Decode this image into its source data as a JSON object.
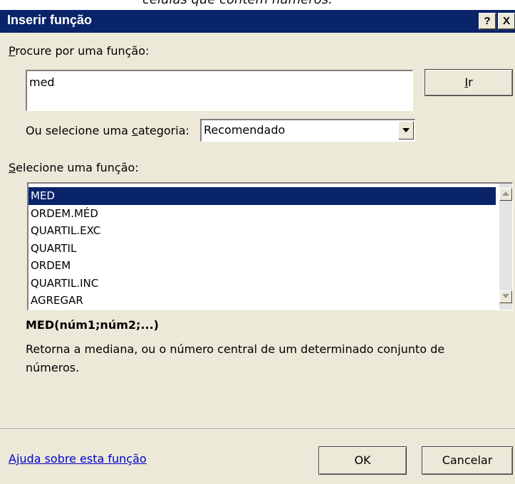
{
  "caption_above": "células que contêm números.",
  "dialog": {
    "title": "Inserir função",
    "help_glyph": "?",
    "close_glyph": "X"
  },
  "search": {
    "label": "rocure por uma função:",
    "label_mnemonic": "P",
    "value": "med",
    "go_label": "r",
    "go_mnemonic": "I"
  },
  "category": {
    "label_before": "Ou selecione uma ",
    "label_mnemonic": "c",
    "label_after": "ategoria:",
    "selected": "Recomendado"
  },
  "function_list": {
    "label": "elecione uma função:",
    "label_mnemonic": "S",
    "items": [
      "MED",
      "ORDEM.MÉD",
      "QUARTIL.EXC",
      "QUARTIL",
      "ORDEM",
      "QUARTIL.INC",
      "AGREGAR"
    ],
    "selected_index": 0
  },
  "details": {
    "signature": "MED(núm1;núm2;...)",
    "description": "Retorna a mediana, ou o número central de um determinado conjunto de números."
  },
  "footer": {
    "help_link": "Ajuda sobre esta função",
    "ok_label": "OK",
    "cancel_label": "Cancelar"
  }
}
